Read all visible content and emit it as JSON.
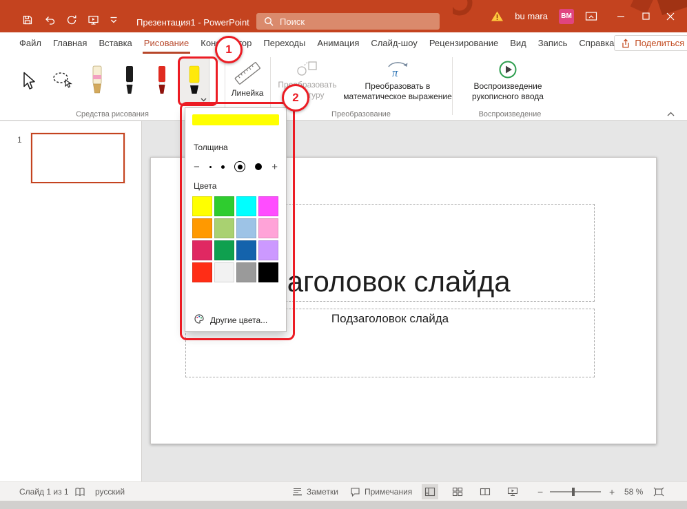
{
  "colors": {
    "titlebar_bg": "#C4431F",
    "annotation_red": "#EC1C24",
    "active_tab": "#B7472A",
    "share_text": "#C24A1F",
    "avatar_bg": "#E0447F",
    "selected_slide_border": "#C0461F",
    "highlighter_yellow": "#FFFF00"
  },
  "titlebar": {
    "title": "Презентация1 - PowerPoint",
    "search_label": "Поиск",
    "user_name": "bu mara",
    "avatar_initials": "ВМ"
  },
  "tabs": {
    "items": [
      {
        "label": "Файл",
        "active": false
      },
      {
        "label": "Главная",
        "active": false
      },
      {
        "label": "Вставка",
        "active": false
      },
      {
        "label": "Рисование",
        "active": true
      },
      {
        "label": "Конструктор",
        "active": false
      },
      {
        "label": "Переходы",
        "active": false
      },
      {
        "label": "Анимация",
        "active": false
      },
      {
        "label": "Слайд-шоу",
        "active": false
      },
      {
        "label": "Рецензирование",
        "active": false
      },
      {
        "label": "Вид",
        "active": false
      },
      {
        "label": "Запись",
        "active": false
      },
      {
        "label": "Справка",
        "active": false
      }
    ],
    "share_label": "Поделиться"
  },
  "ribbon": {
    "group_labels": {
      "drawing_tools": "Средства рисования",
      "convert": "Преобразование",
      "replay": "Воспроизведение"
    },
    "ruler_label": "Линейка",
    "ink_to_shape": {
      "line1": "Преобразовать",
      "line2": "в фигуру"
    },
    "ink_to_math": {
      "line1": "Преобразовать в",
      "line2": "математическое выражение"
    },
    "replay_button": {
      "line1": "Воспроизведение",
      "line2": "рукописного ввода"
    }
  },
  "pen_dropdown": {
    "thickness_label": "Толщина",
    "colors_label": "Цвета",
    "more_colors_label": "Другие цвета...",
    "preview_color": "#FFFF00",
    "decrease_label": "−",
    "increase_label": "+",
    "thickness": {
      "sizes": [
        3,
        5,
        7,
        10
      ],
      "selected_index": 2
    },
    "swatches": [
      "#FFFF00",
      "#2FCC2F",
      "#00FFFF",
      "#FF4DFF",
      "#FF9900",
      "#A9D171",
      "#9DC3E6",
      "#FFA3D8",
      "#E02862",
      "#0FA04F",
      "#1463AC",
      "#CC99FF",
      "#FF2D16",
      "#F2F2F2",
      "#9A9A9A",
      "#000000"
    ]
  },
  "slides_panel": {
    "slide_number": "1"
  },
  "slide": {
    "title_placeholder": "Заголовок слайда",
    "subtitle_placeholder": "Подзаголовок слайда"
  },
  "statusbar": {
    "slide_counter": "Слайд 1 из 1",
    "language": "русский",
    "notes_label": "Заметки",
    "comments_label": "Примечания",
    "zoom_decrease": "−",
    "zoom_increase": "+",
    "zoom_value": "58 %"
  },
  "annotations": {
    "step1": "1",
    "step2": "2"
  }
}
